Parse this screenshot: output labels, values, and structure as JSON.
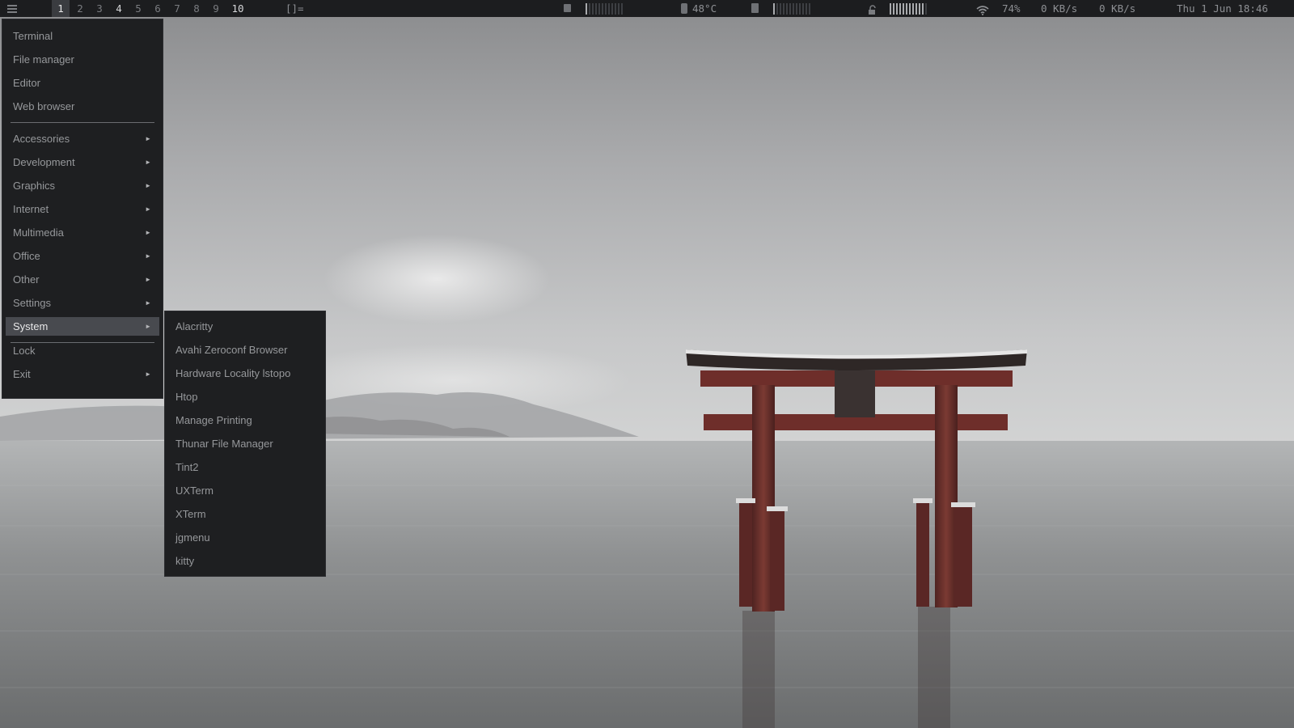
{
  "topbar": {
    "menu_icon": "menu-icon",
    "workspaces": [
      {
        "label": "1",
        "state": "active"
      },
      {
        "label": "2",
        "state": "empty"
      },
      {
        "label": "3",
        "state": "empty"
      },
      {
        "label": "4",
        "state": "occupied"
      },
      {
        "label": "5",
        "state": "empty"
      },
      {
        "label": "6",
        "state": "empty"
      },
      {
        "label": "7",
        "state": "empty"
      },
      {
        "label": "8",
        "state": "empty"
      },
      {
        "label": "9",
        "state": "empty"
      },
      {
        "label": "10",
        "state": "occupied"
      }
    ],
    "layout": "[]=",
    "cpu": {
      "icon": "cpu-icon",
      "level": 0.1
    },
    "temperature": {
      "icon": "thermometer-icon",
      "value": "48°C"
    },
    "memory": {
      "icon": "memory-icon",
      "level": 0.1
    },
    "disk": {
      "icon": "lock-icon",
      "level": 0.95
    },
    "wifi": {
      "icon": "wifi-icon",
      "value": "74%"
    },
    "net_down": "0 KB/s",
    "net_up": "0 KB/s",
    "clock": "Thu  1 Jun 18:46"
  },
  "menu": {
    "favorites": [
      "Terminal",
      "File manager",
      "Editor",
      "Web browser"
    ],
    "categories": [
      "Accessories",
      "Development",
      "Graphics",
      "Internet",
      "Multimedia",
      "Office",
      "Other",
      "Settings",
      "System"
    ],
    "selected": "System",
    "session": [
      {
        "label": "Lock",
        "has_submenu": false
      },
      {
        "label": "Exit",
        "has_submenu": true
      }
    ],
    "submenu_arrow": "►"
  },
  "submenu": {
    "title": "System",
    "items": [
      "Alacritty",
      "Avahi Zeroconf Browser",
      "Hardware Locality lstopo",
      "Htop",
      "Manage Printing",
      "Thunar File Manager",
      "Tint2",
      "UXTerm",
      "XTerm",
      "jgmenu",
      "kitty"
    ]
  },
  "colors": {
    "bar_bg": "#1c1d1f",
    "menu_bg": "#1e1f21",
    "menu_selected": "#484a4f",
    "menu_text": "#96989b",
    "gate_red": "#6e2e2a"
  }
}
